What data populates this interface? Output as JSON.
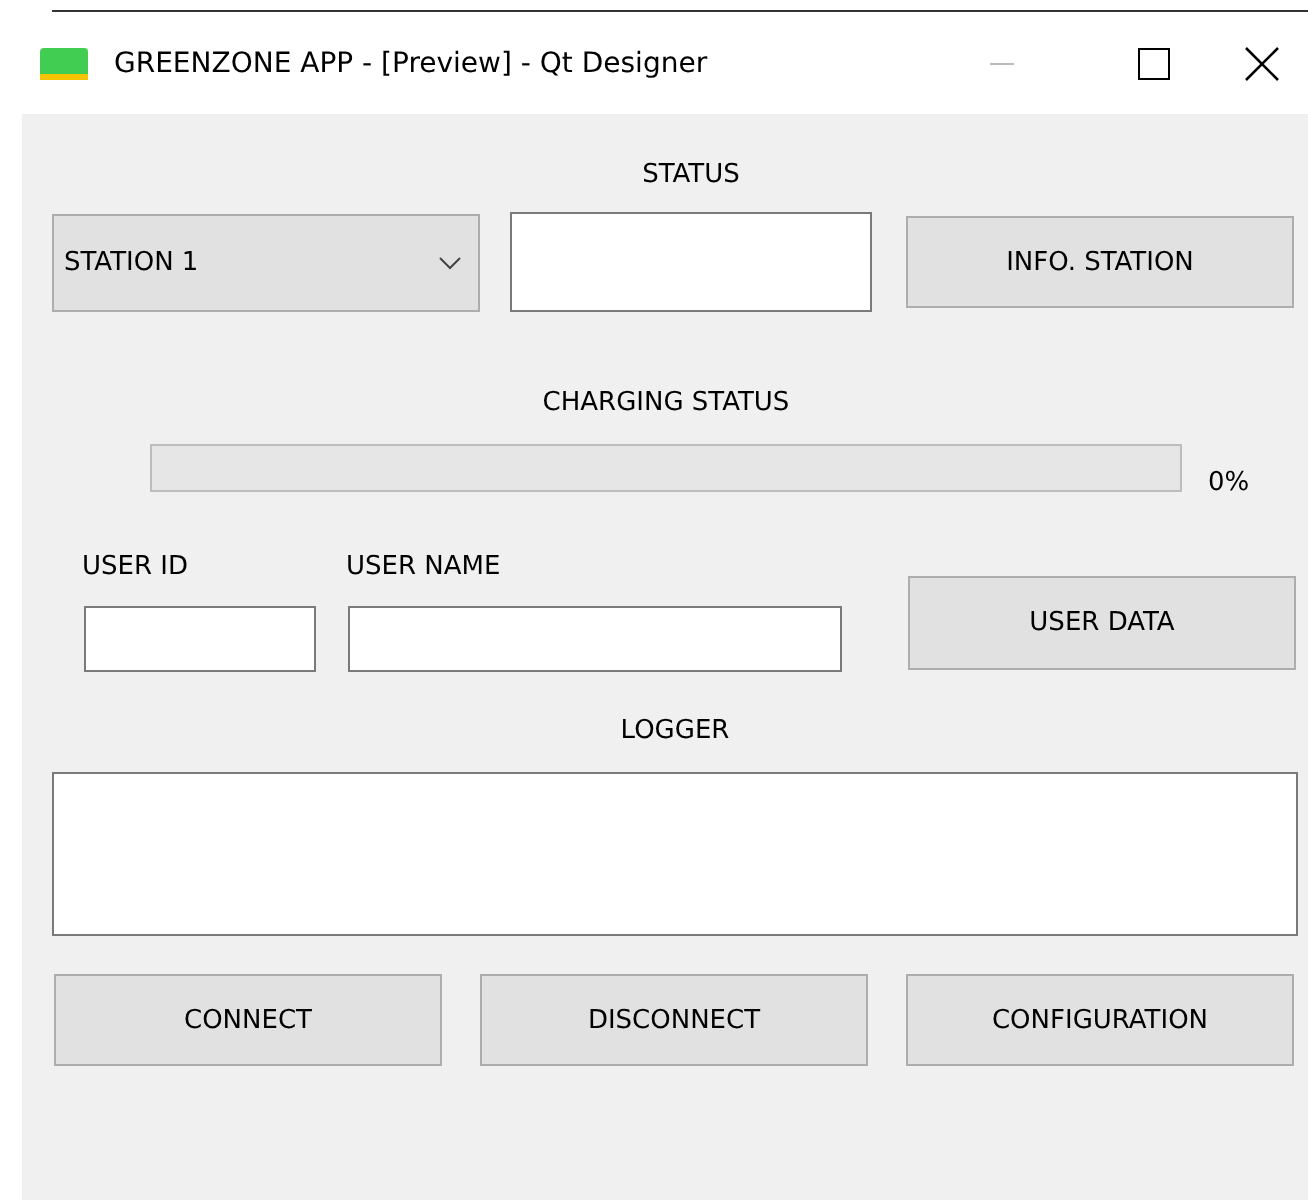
{
  "window": {
    "title": "GREENZONE APP - [Preview] - Qt Designer"
  },
  "status": {
    "label": "STATUS"
  },
  "station_combo": {
    "value": "STATION 1"
  },
  "info_button": "INFO. STATION",
  "charging": {
    "label": "CHARGING STATUS",
    "level": 0,
    "reading": "0%"
  },
  "user": {
    "id_label": "USER ID",
    "name_label": "USER NAME",
    "button": "USER DATA"
  },
  "logger": {
    "label": "LOGGER"
  },
  "buttons": [
    "CONNECT",
    "DISCONNECT",
    "CONFIGURATION"
  ]
}
